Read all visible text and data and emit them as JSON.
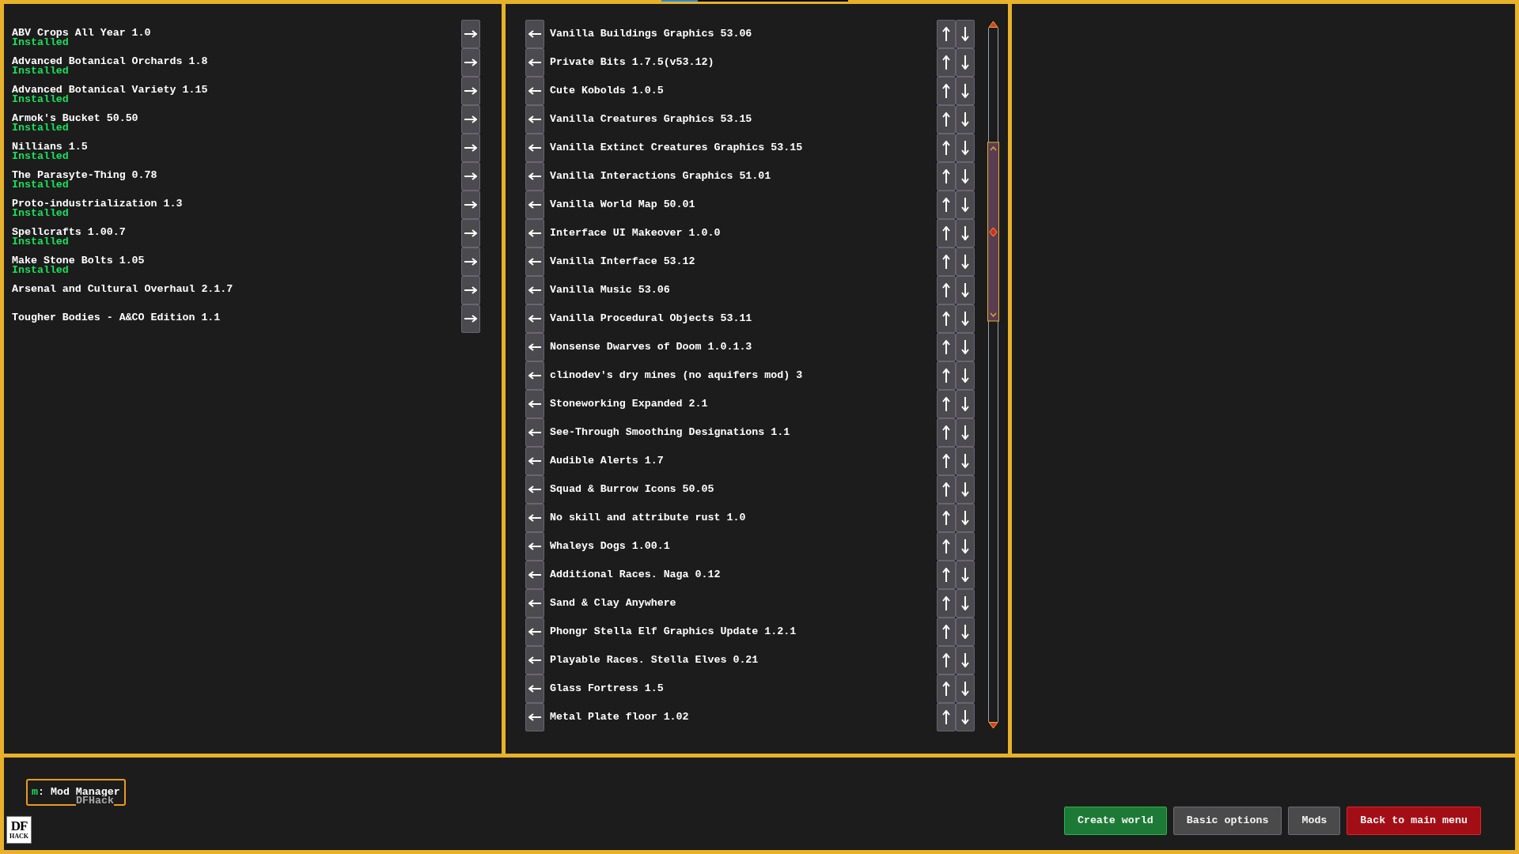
{
  "available_mods": {
    "items": [
      {
        "name": "ABV Crops All Year 1.0",
        "status": "Installed"
      },
      {
        "name": "Advanced Botanical Orchards 1.8",
        "status": "Installed"
      },
      {
        "name": "Advanced Botanical Variety 1.15",
        "status": "Installed"
      },
      {
        "name": "Armok's Bucket 50.50",
        "status": "Installed"
      },
      {
        "name": "Nillians 1.5",
        "status": "Installed"
      },
      {
        "name": "The Parasyte-Thing 0.78",
        "status": "Installed"
      },
      {
        "name": "Proto-industrialization 1.3",
        "status": "Installed"
      },
      {
        "name": "Spellcrafts 1.00.7",
        "status": "Installed"
      },
      {
        "name": "Make Stone Bolts 1.05",
        "status": "Installed"
      },
      {
        "name": "Arsenal and Cultural Overhaul 2.1.7"
      },
      {
        "name": "Tougher Bodies - A&CO Edition 1.1"
      }
    ]
  },
  "active_mods": {
    "items": [
      {
        "name": "Vanilla Buildings Graphics 53.06"
      },
      {
        "name": "Private Bits 1.7.5(v53.12)"
      },
      {
        "name": "Cute Kobolds 1.0.5"
      },
      {
        "name": "Vanilla Creatures Graphics 53.15"
      },
      {
        "name": "Vanilla Extinct Creatures Graphics 53.15"
      },
      {
        "name": "Vanilla Interactions Graphics 51.01"
      },
      {
        "name": "Vanilla World Map 50.01"
      },
      {
        "name": "Interface UI Makeover 1.0.0"
      },
      {
        "name": "Vanilla Interface 53.12"
      },
      {
        "name": "Vanilla Music 53.06"
      },
      {
        "name": "Vanilla Procedural Objects 53.11"
      },
      {
        "name": "Nonsense Dwarves of Doom 1.0.1.3"
      },
      {
        "name": "clinodev's dry mines (no aquifers mod) 3"
      },
      {
        "name": "Stoneworking Expanded 2.1"
      },
      {
        "name": "See-Through Smoothing Designations 1.1"
      },
      {
        "name": "Audible Alerts 1.7"
      },
      {
        "name": "Squad & Burrow Icons 50.05"
      },
      {
        "name": "No skill and attribute rust 1.0"
      },
      {
        "name": "Whaleys Dogs 1.00.1"
      },
      {
        "name": "Additional Races. Naga 0.12"
      },
      {
        "name": "Sand & Clay Anywhere"
      },
      {
        "name": "Phongr Stella Elf Graphics Update 1.2.1"
      },
      {
        "name": "Playable Races. Stella Elves 0.21"
      },
      {
        "name": "Glass Fortress 1.5"
      },
      {
        "name": "Metal Plate floor 1.02"
      }
    ]
  },
  "overlay_button": {
    "hotkey": "m",
    "label": ": Mod Manager",
    "source": "DFHack"
  },
  "logo": {
    "lines": [
      "DF",
      "HACK"
    ]
  },
  "buttons": [
    {
      "label": "Create world",
      "kind": "confirm"
    },
    {
      "label": "Basic options",
      "kind": "neutral"
    },
    {
      "label": "Mods",
      "kind": "neutral"
    },
    {
      "label": "Back to main menu",
      "kind": "danger"
    }
  ]
}
